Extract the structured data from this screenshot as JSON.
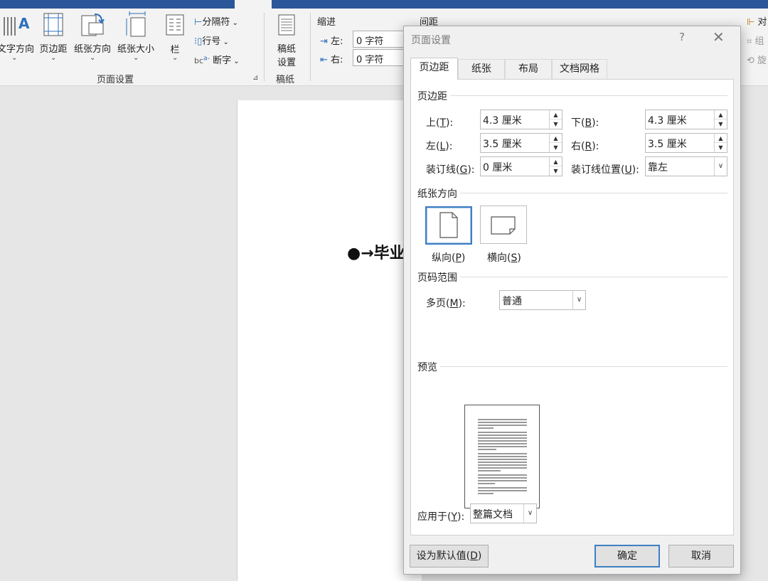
{
  "ribbon": {
    "text_direction": "文字方向",
    "margins": "页边距",
    "orientation": "纸张方向",
    "size": "纸张大小",
    "columns": "栏",
    "breaks": "分隔符",
    "line_numbers": "行号",
    "hyphenation": "断字",
    "page_setup_group": "页面设置",
    "manuscript_btn_line1": "稿纸",
    "manuscript_btn_line2": "设置",
    "manuscript_group": "稿纸",
    "indent_header": "缩进",
    "spacing_header": "间距",
    "indent_left_label": "左:",
    "indent_left_value": "0 字符",
    "indent_right_label": "右:",
    "indent_right_value": "0 字符",
    "right_partial_1": "对",
    "right_partial_2": "组",
    "right_partial_3": "旋"
  },
  "document": {
    "visible_text": "●→毕业"
  },
  "dialog": {
    "title": "页面设置",
    "help": "?",
    "close": "✕",
    "tabs": [
      "页边距",
      "纸张",
      "布局",
      "文档网格"
    ],
    "margins_section": "页边距",
    "top_label": "上(T):",
    "top_key": "T",
    "top_value": "4.3 厘米",
    "bottom_label": "下(B):",
    "bottom_key": "B",
    "bottom_value": "4.3 厘米",
    "left_label": "左(L):",
    "left_key": "L",
    "left_value": "3.5 厘米",
    "right_label": "右(R):",
    "right_key": "R",
    "right_value": "3.5 厘米",
    "gutter_label": "装订线(G):",
    "gutter_key": "G",
    "gutter_value": "0 厘米",
    "gutter_pos_label": "装订线位置(U):",
    "gutter_pos_key": "U",
    "gutter_pos_value": "靠左",
    "orientation_section": "纸张方向",
    "portrait_label": "纵向(P)",
    "portrait_key": "P",
    "landscape_label": "横向(S)",
    "landscape_key": "S",
    "pages_section": "页码范围",
    "multiple_pages_label": "多页(M):",
    "multiple_pages_key": "M",
    "multiple_pages_value": "普通",
    "preview_section": "预览",
    "apply_to_label": "应用于(Y):",
    "apply_to_key": "Y",
    "apply_to_value": "整篇文档",
    "default_button": "设为默认值(D)",
    "default_key": "D",
    "ok_button": "确定",
    "cancel_button": "取消"
  },
  "colors": {
    "title_bar": "#2b579a",
    "selection_blue": "#3f7fc1",
    "dialog_bg": "#f0f0f0"
  }
}
